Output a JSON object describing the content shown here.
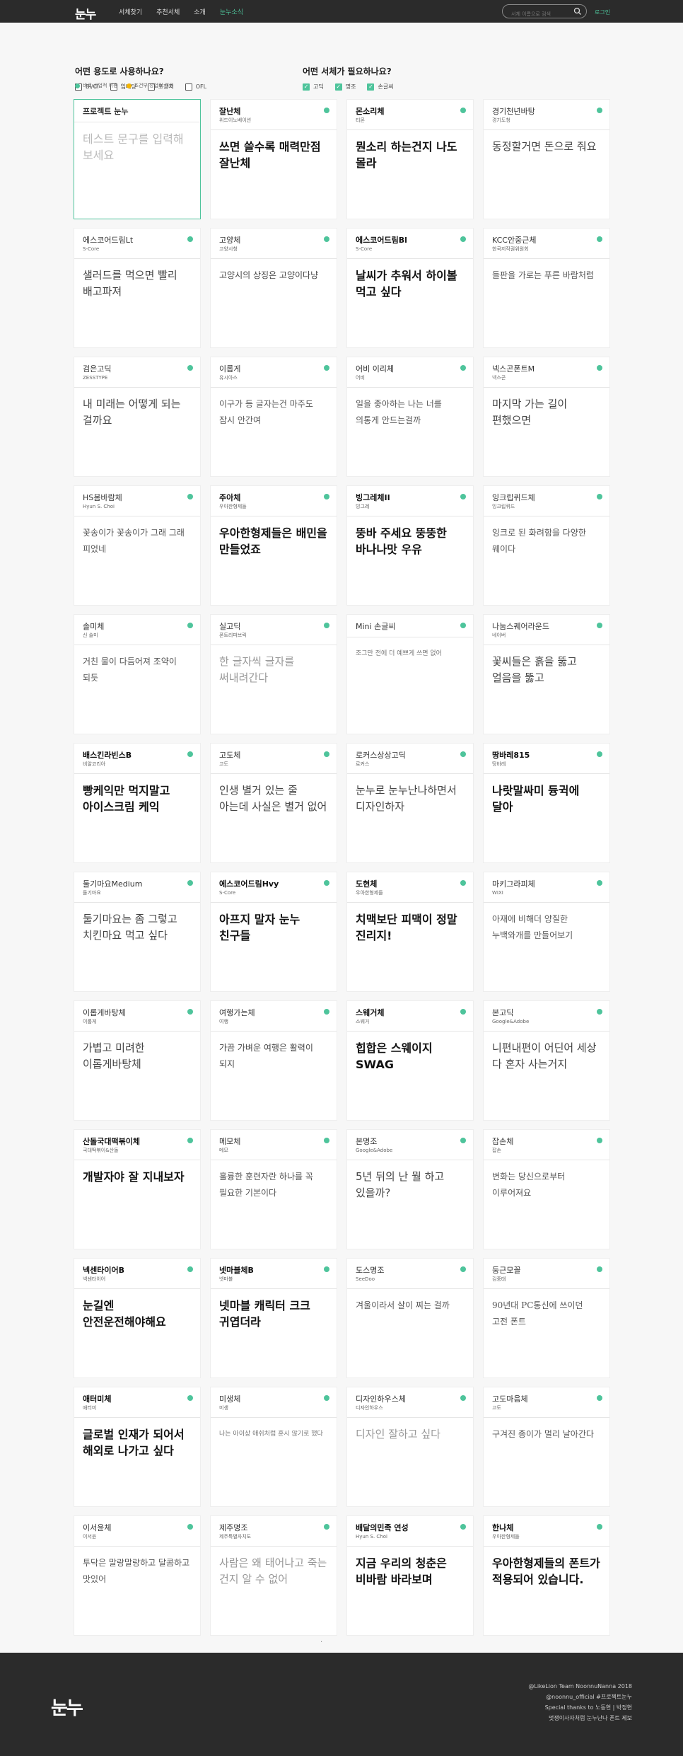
{
  "header": {
    "logo": "눈누",
    "nav": [
      {
        "label": "서체찾기",
        "active": false
      },
      {
        "label": "추천서체",
        "active": false
      },
      {
        "label": "소개",
        "active": false
      },
      {
        "label": "눈누소식",
        "active": true
      }
    ],
    "search_placeholder": "서체 이름으로 검색",
    "search_icon": "search-icon",
    "login": "로그인"
  },
  "filters": {
    "usage": {
      "title": "어떤 용도로 사용하나요?",
      "options": [
        {
          "label": "BI/CI",
          "checked": false
        },
        {
          "label": "임베딩",
          "checked": false
        },
        {
          "label": "포장지",
          "checked": false
        },
        {
          "label": "OFL",
          "checked": false
        }
      ]
    },
    "type": {
      "title": "어떤 서체가 필요하나요?",
      "options": [
        {
          "label": "고딕",
          "checked": true
        },
        {
          "label": "명조",
          "checked": true
        },
        {
          "label": "손글씨",
          "checked": true
        }
      ]
    }
  },
  "legend": {
    "free": {
      "label": "바로 상업적 이용",
      "color": "#4ec49b"
    },
    "conditional": {
      "label": "조건부 상업적 이용",
      "color": "#f5b400"
    }
  },
  "project_card": {
    "title": "프로젝트 눈누",
    "placeholder": "테스트 문구를 입력해보세요"
  },
  "fonts": [
    {
      "name": "잘난체",
      "maker": "위드이노베이션",
      "sample": "쓰면 쓸수록 매력만점 잘난체",
      "style": "bold"
    },
    {
      "name": "몬소리체",
      "maker": "티몬",
      "sample": "뭔소리 하는건지 나도 몰라",
      "style": "bold"
    },
    {
      "name": "경기천년바탕",
      "maker": "경기도청",
      "sample": "동정할거면 돈으로 줘요",
      "style": "normal"
    },
    {
      "name": "에스코어드림Lt",
      "maker": "S-Core",
      "sample": "샐러드를 먹으면 빨리 배고파져",
      "style": "normal"
    },
    {
      "name": "고양체",
      "maker": "고양시청",
      "sample": "고양시의 상징은 고양이다냥",
      "style": "small"
    },
    {
      "name": "에스코어드림Bl",
      "maker": "S-Core",
      "sample": "날씨가 추워서 하이볼 먹고 싶다",
      "style": "bold"
    },
    {
      "name": "KCC안중근체",
      "maker": "한국저작권위원회",
      "sample": "들판을 가로는 푸른 바람처럼",
      "style": "hand"
    },
    {
      "name": "검은고딕",
      "maker": "ZESSTYPE",
      "sample": "내 미래는 어떻게 되는 걸까요",
      "style": "normal"
    },
    {
      "name": "이롭게",
      "maker": "유시아스",
      "sample": "이구가 등 글자는건 마주도 잠시 안간여",
      "style": "hand"
    },
    {
      "name": "어비 이리체",
      "maker": "어비",
      "sample": "일을 좋아하는 나는 너를 의통게 안드는걸까",
      "style": "hand"
    },
    {
      "name": "넥스곤폰트M",
      "maker": "넥스곤",
      "sample": "마지막 가는 길이 편했으면",
      "style": "normal"
    },
    {
      "name": "HS봄바람체",
      "maker": "Hyun S. Choi",
      "sample": "꽃송이가 꽃송이가 그래 그래 피었네",
      "style": "hand"
    },
    {
      "name": "주아체",
      "maker": "우아한형제들",
      "sample": "우아한형제들은 배민을 만들었죠",
      "style": "bold"
    },
    {
      "name": "빙그레체II",
      "maker": "빙그레",
      "sample": "뚱바 주세요 뚱뚱한 바나나맛 우유",
      "style": "bold"
    },
    {
      "name": "잉크립퀴드체",
      "maker": "잉크립퀴드",
      "sample": "잉크로 된 화려함을 다양한 웨이다",
      "style": "hand"
    },
    {
      "name": "솔미체",
      "maker": "신 솔미",
      "sample": "거친 물이 다듬어져 조약이 되듯",
      "style": "hand"
    },
    {
      "name": "실고딕",
      "maker": "폰트리파브릭",
      "sample": "한 글자씩 글자를 써내려간다",
      "style": "light"
    },
    {
      "name": "Mini 손글씨",
      "maker": "",
      "sample": "조그만 전에 더 예쁘게 쓰면 없어",
      "style": "tiny"
    },
    {
      "name": "나눔스퀘어라운드",
      "maker": "네이버",
      "sample": "꽃씨들은 흙을 뚫고 얼음을 뚫고",
      "style": "normal"
    },
    {
      "name": "배스킨라빈스B",
      "maker": "비알코리아",
      "sample": "빵케익만 먹지말고 아이스크림 케익",
      "style": "bold"
    },
    {
      "name": "고도체",
      "maker": "고도",
      "sample": "인생 별거 있는 줄 아는데 사실은 별거 없어",
      "style": "normal"
    },
    {
      "name": "로커스상상고딕",
      "maker": "로커스",
      "sample": "눈누로 눈누난나하면서 디자인하자",
      "style": "normal"
    },
    {
      "name": "땅바레815",
      "maker": "땅바레",
      "sample": "나랏말싸미 듕귁에 달아",
      "style": "bold"
    },
    {
      "name": "둘기마요Medium",
      "maker": "둘기마요",
      "sample": "둘기마요는 좀 그렇고 치킨마요 먹고 싶다",
      "style": "normal"
    },
    {
      "name": "에스코어드림Hvy",
      "maker": "S-Core",
      "sample": "아프지 말자 눈누 친구들",
      "style": "bold"
    },
    {
      "name": "도현체",
      "maker": "우아한형제들",
      "sample": "치맥보단 피맥이 정말 진리지!",
      "style": "bold"
    },
    {
      "name": "마키그라피체",
      "maker": "WIXI",
      "sample": "아재에 비해더 양질한 누백와개를 만들어보기",
      "style": "hand"
    },
    {
      "name": "이롭게바탕체",
      "maker": "이롭게",
      "sample": "가볍고 미려한 이롭게바탕체",
      "style": "normal"
    },
    {
      "name": "여행가는체",
      "maker": "여행",
      "sample": "가끔 가벼운 여행은 활력이 되지",
      "style": "small"
    },
    {
      "name": "스웨거체",
      "maker": "스웨거",
      "sample": "힙합은 스웨이지 SWAG",
      "style": "bold"
    },
    {
      "name": "본고딕",
      "maker": "Google&Adobe",
      "sample": "니편내편이 어딘어 세상 다 혼자 사는거지",
      "style": "normal"
    },
    {
      "name": "산돌국대떡볶이체",
      "maker": "국대떡볶이&산돌",
      "sample": "개발자야 잘 지내보자",
      "style": "bold"
    },
    {
      "name": "메모체",
      "maker": "메모",
      "sample": "훌륭한 훈련자란 하나를 꼭 필요한 기본이다",
      "style": "hand"
    },
    {
      "name": "본명조",
      "maker": "Google&Adobe",
      "sample": "5년 뒤의 난 뭘 하고 있을까?",
      "style": "normal"
    },
    {
      "name": "잡손체",
      "maker": "잡손",
      "sample": "변화는 당신으로부터 이루어져요",
      "style": "hand"
    },
    {
      "name": "넥센타이어B",
      "maker": "넥센타이어",
      "sample": "눈길엔 안전운전해야해요",
      "style": "bold"
    },
    {
      "name": "넷마블체B",
      "maker": "넷마블",
      "sample": "넷마블 캐릭터 크크 귀엽더라",
      "style": "bold"
    },
    {
      "name": "도스명조",
      "maker": "SeeDoo",
      "sample": "겨울이라서 살이 찌는 걸까",
      "style": "hand"
    },
    {
      "name": "둥근모꼴",
      "maker": "김중태",
      "sample": "90년대 PC통신에 쓰이던 고전 폰트",
      "style": "hand"
    },
    {
      "name": "애터미체",
      "maker": "애터미",
      "sample": "글로벌 인재가 되어서 해외로 나가고 싶다",
      "style": "bold"
    },
    {
      "name": "미생체",
      "maker": "미생",
      "sample": "나는 아이상 애쉬처럼 훈시 않기로 했다",
      "style": "tiny"
    },
    {
      "name": "디자인하우스체",
      "maker": "디자인하우스",
      "sample": "디자인 잘하고 싶다",
      "style": "light"
    },
    {
      "name": "고도마음체",
      "maker": "고도",
      "sample": "구겨진 종이가 멀리 날아간다",
      "style": "hand"
    },
    {
      "name": "이서윤체",
      "maker": "이서윤",
      "sample": "투닥은 말랑말랑하고 달콤하고 맛있어",
      "style": "hand"
    },
    {
      "name": "제주명조",
      "maker": "제주특별자치도",
      "sample": "사람은 왜 태어나고 죽는 건지 알 수 없어",
      "style": "light"
    },
    {
      "name": "배달의민족 연성",
      "maker": "Hyun S. Choi",
      "sample": "지금 우리의 청춘은 비바람 바라보며",
      "style": "bold"
    },
    {
      "name": "한나체",
      "maker": "우아한형제들",
      "sample": "우아한형제들의 폰트가 적용되어 있습니다.",
      "style": "bold"
    }
  ],
  "pager": "·",
  "footer": {
    "logo": "눈누",
    "credits": [
      "@LikeLion Team NoonnuNanna 2018",
      "@noonnu_official  #프로젝트눈누",
      "Special thanks to  노동현 | 박정현",
      "멋쟁이사자처럼 눈누난나 폰트 제보"
    ]
  }
}
